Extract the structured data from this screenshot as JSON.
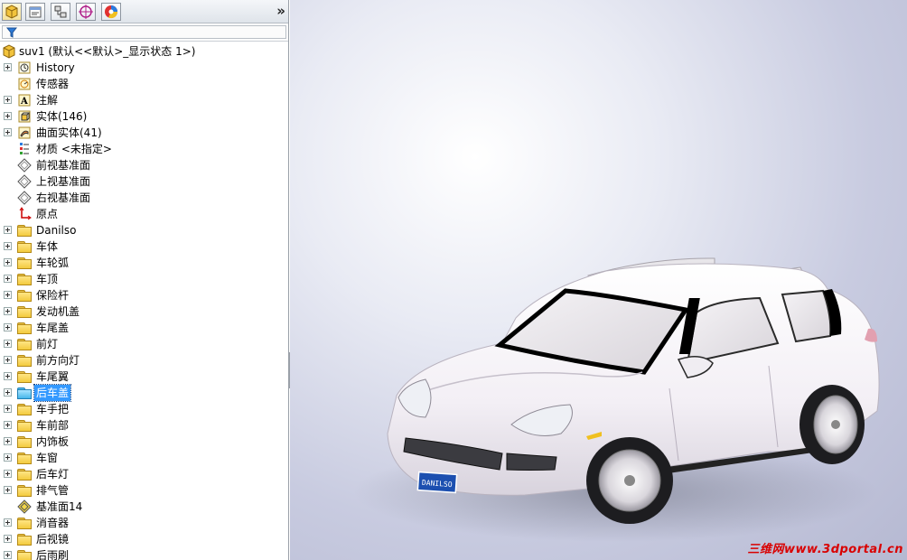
{
  "panel": {
    "tabs": [
      "feature-manager-tab",
      "property-manager-tab",
      "configuration-manager-tab",
      "dimxpert-manager-tab",
      "display-manager-tab"
    ],
    "chevron": "»",
    "filter_icon": "filter-icon"
  },
  "tree": {
    "root": "suv1  (默认<<默认>_显示状态 1>)",
    "items": [
      {
        "label": "History",
        "icon": "history-icon",
        "expand": true
      },
      {
        "label": "传感器",
        "icon": "sensor-icon",
        "expand": false
      },
      {
        "label": "注解",
        "icon": "annotation-icon",
        "expand": true
      },
      {
        "label": "实体(146)",
        "icon": "solid-body-icon",
        "expand": true
      },
      {
        "label": "曲面实体(41)",
        "icon": "surface-body-icon",
        "expand": true
      },
      {
        "label": "材质 <未指定>",
        "icon": "material-icon",
        "expand": false
      },
      {
        "label": "前视基准面",
        "icon": "plane-icon",
        "expand": false
      },
      {
        "label": "上视基准面",
        "icon": "plane-icon",
        "expand": false
      },
      {
        "label": "右视基准面",
        "icon": "plane-icon",
        "expand": false
      },
      {
        "label": "原点",
        "icon": "origin-icon",
        "expand": false
      },
      {
        "label": "Danilso",
        "icon": "folder-icon",
        "expand": true
      },
      {
        "label": "车体",
        "icon": "folder-icon",
        "expand": true
      },
      {
        "label": "车轮弧",
        "icon": "folder-icon",
        "expand": true
      },
      {
        "label": "车顶",
        "icon": "folder-icon",
        "expand": true
      },
      {
        "label": "保险杆",
        "icon": "folder-icon",
        "expand": true
      },
      {
        "label": "发动机盖",
        "icon": "folder-icon",
        "expand": true
      },
      {
        "label": "车尾盖",
        "icon": "folder-icon",
        "expand": true
      },
      {
        "label": "前灯",
        "icon": "folder-icon",
        "expand": true
      },
      {
        "label": "前方向灯",
        "icon": "folder-icon",
        "expand": true
      },
      {
        "label": "车尾翼",
        "icon": "folder-icon",
        "expand": true
      },
      {
        "label": "后车盖",
        "icon": "folder-icon",
        "expand": true,
        "selected": true
      },
      {
        "label": "车手把",
        "icon": "folder-icon",
        "expand": true
      },
      {
        "label": "车前部",
        "icon": "folder-icon",
        "expand": true
      },
      {
        "label": "内饰板",
        "icon": "folder-icon",
        "expand": true
      },
      {
        "label": "车窗",
        "icon": "folder-icon",
        "expand": true
      },
      {
        "label": "后车灯",
        "icon": "folder-icon",
        "expand": true
      },
      {
        "label": "排气管",
        "icon": "folder-icon",
        "expand": true
      },
      {
        "label": "基准面14",
        "icon": "plane-icon-yellow",
        "expand": false
      },
      {
        "label": "消音器",
        "icon": "folder-icon",
        "expand": true
      },
      {
        "label": "后视镜",
        "icon": "folder-icon",
        "expand": true
      },
      {
        "label": "后雨刷",
        "icon": "folder-icon",
        "expand": true
      }
    ]
  },
  "viewport": {
    "license_plate": "DANILSO",
    "watermark": "三维网www.3dportal.cn"
  },
  "colors": {
    "selection": "#3399ff",
    "watermark": "#d90000",
    "folder": "#f3cb3e"
  }
}
